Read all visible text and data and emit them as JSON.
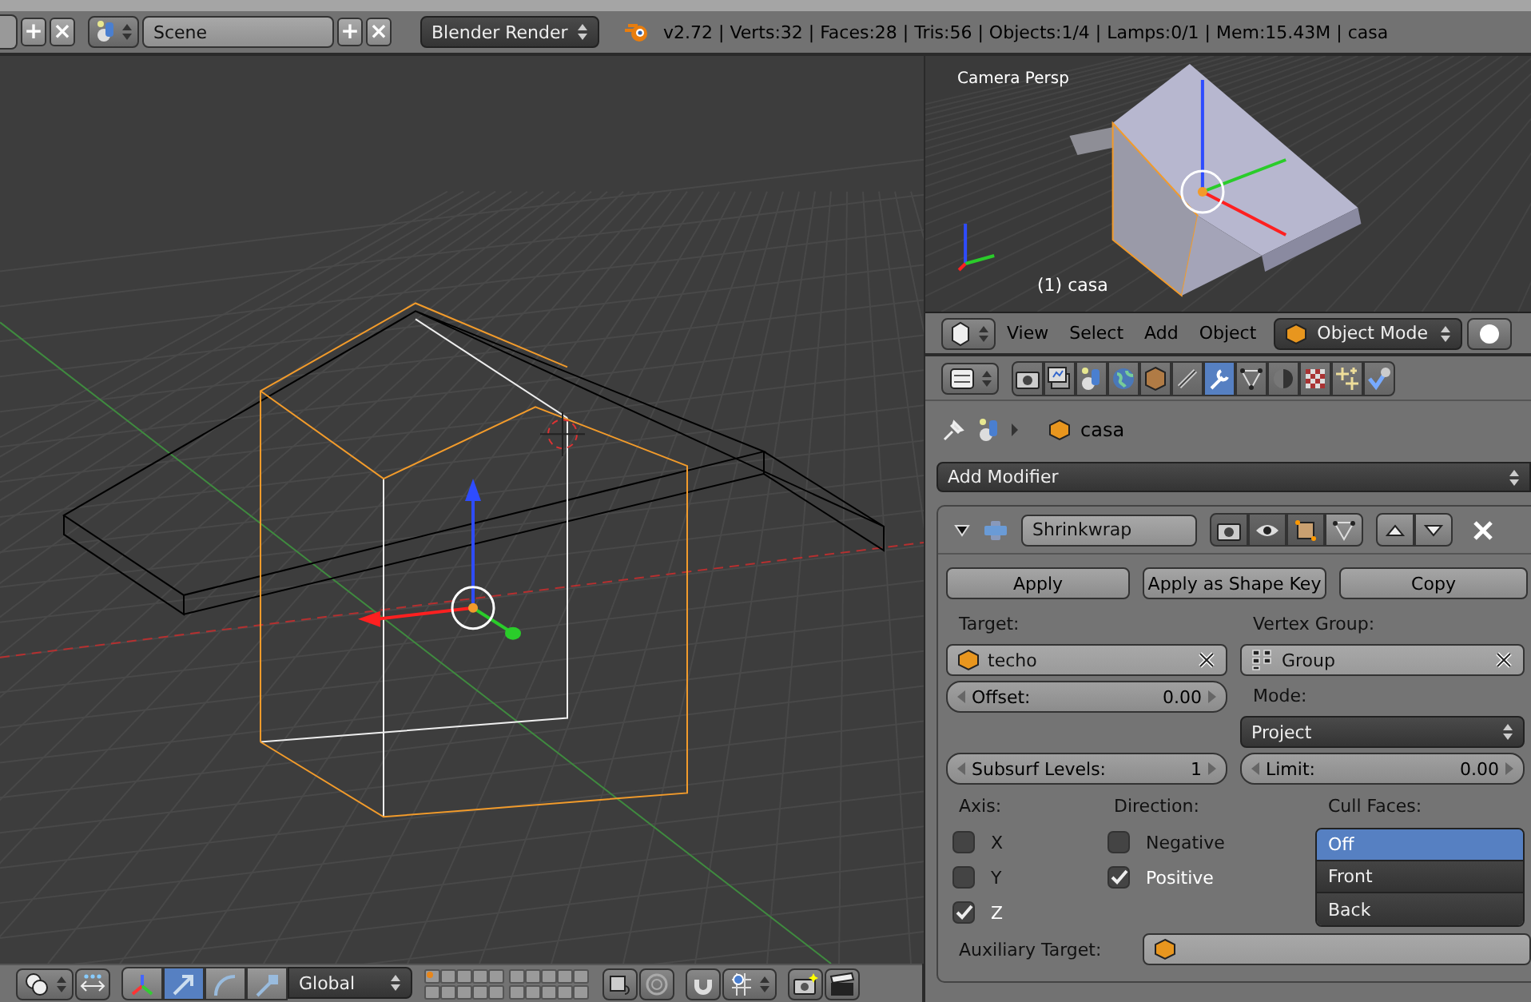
{
  "top_bar": {
    "screen_buttons": [
      "+",
      "×"
    ],
    "scene": "Scene",
    "scene_buttons": [
      "+",
      "×"
    ],
    "renderer": "Blender Render",
    "info": "v2.72 | Verts:32 | Faces:28 | Tris:56 | Objects:1/4 | Lamps:0/1 | Mem:15.43M | casa"
  },
  "camera_view": {
    "title": "Camera Persp",
    "object_label": "(1) casa"
  },
  "view_header": {
    "menus": [
      "View",
      "Select",
      "Add",
      "Object"
    ],
    "mode": "Object Mode"
  },
  "properties": {
    "tabs": [
      {
        "kind": "render",
        "selected": false
      },
      {
        "kind": "layers",
        "selected": false
      },
      {
        "kind": "scene",
        "selected": false
      },
      {
        "kind": "world",
        "selected": false
      },
      {
        "kind": "object",
        "selected": false
      },
      {
        "kind": "constraints",
        "selected": false
      },
      {
        "kind": "modifiers",
        "selected": true
      },
      {
        "kind": "data",
        "selected": false
      },
      {
        "kind": "material",
        "selected": false
      },
      {
        "kind": "texture",
        "selected": false
      },
      {
        "kind": "particles",
        "selected": false
      },
      {
        "kind": "physics",
        "selected": false
      }
    ],
    "breadcrumb": "casa",
    "add_modifier": "Add Modifier",
    "modifier": {
      "expanded": true,
      "name": "Shrinkwrap",
      "buttons": [
        "Apply",
        "Apply as Shape Key",
        "Copy"
      ],
      "target_label": "Target:",
      "target": "techo",
      "vertex_group_label": "Vertex Group:",
      "vertex_group": "Group",
      "offset": {
        "label": "Offset:",
        "value": "0.00"
      },
      "mode_label": "Mode:",
      "mode": "Project",
      "subsurf": {
        "label": "Subsurf Levels:",
        "value": "1"
      },
      "limit": {
        "label": "Limit:",
        "value": "0.00"
      },
      "axis_label": "Axis:",
      "axes": [
        {
          "label": "X",
          "checked": false
        },
        {
          "label": "Y",
          "checked": false
        },
        {
          "label": "Z",
          "checked": true
        }
      ],
      "direction_label": "Direction:",
      "directions": [
        {
          "label": "Negative",
          "checked": false
        },
        {
          "label": "Positive",
          "checked": true
        }
      ],
      "cull_label": "Cull Faces:",
      "cull_options": [
        {
          "label": "Off",
          "selected": true
        },
        {
          "label": "Front",
          "selected": false
        },
        {
          "label": "Back",
          "selected": false
        }
      ],
      "aux_label": "Auxiliary Target:"
    }
  },
  "bottom_toolbar": {
    "manipulators": [
      {
        "kind": "axes",
        "selected": false
      },
      {
        "kind": "translate",
        "selected": true
      },
      {
        "kind": "rotate",
        "selected": false
      },
      {
        "kind": "scale",
        "selected": false
      }
    ],
    "orientation": "Global"
  }
}
